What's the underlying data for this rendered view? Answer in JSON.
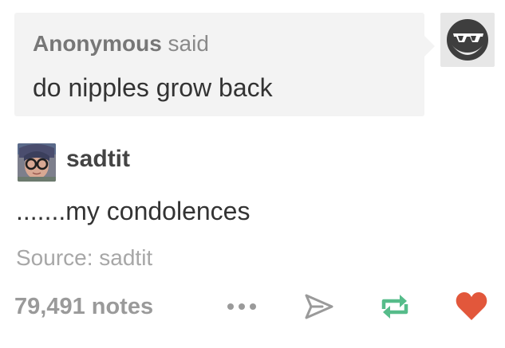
{
  "ask": {
    "asker_name": "Anonymous",
    "asker_said": " said",
    "question": "do nipples grow back",
    "asker_avatar_icon": "sunglasses-face-icon"
  },
  "answer": {
    "author_name": "sadtit",
    "author_avatar_icon": "user-avatar-photo",
    "text": ".......my condolences"
  },
  "source": {
    "label": "Source: sadtit"
  },
  "footer": {
    "notes": "79,491 notes",
    "icons": [
      "more-dots-icon",
      "share-paper-plane-icon",
      "reblog-icon",
      "heart-icon"
    ]
  },
  "colors": {
    "reblog": "#56bc8a",
    "like": "#e2573b",
    "share": "#9a9a9a",
    "bubble": "#f3f3f3",
    "anon_avatar": "#3e3e3e"
  }
}
